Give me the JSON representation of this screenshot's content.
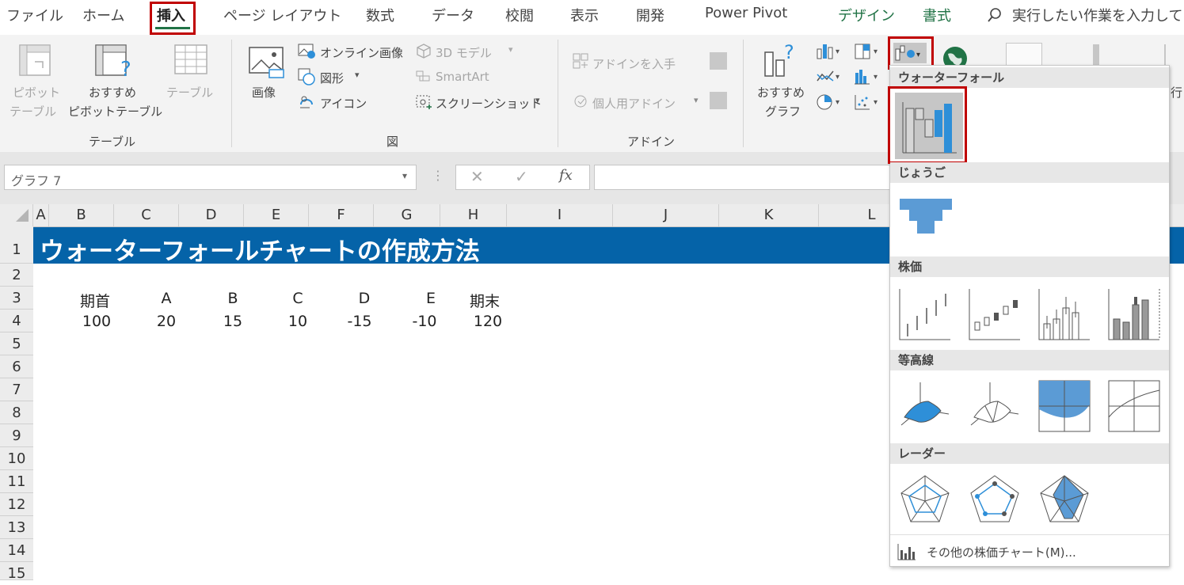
{
  "tabs": [
    {
      "label": "ファイル"
    },
    {
      "label": "ホーム"
    },
    {
      "label": "挿入"
    },
    {
      "label": "ページ レイアウト"
    },
    {
      "label": "数式"
    },
    {
      "label": "データ"
    },
    {
      "label": "校閲"
    },
    {
      "label": "表示"
    },
    {
      "label": "開発"
    },
    {
      "label": "Power Pivot"
    },
    {
      "label": "デザイン"
    },
    {
      "label": "書式"
    }
  ],
  "tellme": {
    "text": "実行したい作業を入力して"
  },
  "ribbon": {
    "table_group": {
      "pivot1": "ピボット",
      "pivot2": "テーブル",
      "rec1": "おすすめ",
      "rec2": "ピボットテーブル",
      "table": "テーブル",
      "label": "テーブル"
    },
    "illust_group": {
      "picture": "画像",
      "online": "オンライン画像",
      "shapes": "図形",
      "icons": "アイコン",
      "model3d": "3D モデル",
      "smartart": "SmartArt",
      "screenshot": "スクリーンショット",
      "label": "図"
    },
    "addin_group": {
      "get": "アドインを入手",
      "personal": "個人用アドイン",
      "label": "アドイン"
    },
    "chart_group": {
      "rec1": "おすすめ",
      "rec2": "グラフ",
      "partial": "行"
    }
  },
  "formula_bar": {
    "namebox": "グラフ 7",
    "fx": "fx"
  },
  "columns": [
    "A",
    "B",
    "C",
    "D",
    "E",
    "F",
    "G",
    "H",
    "I",
    "J",
    "K",
    "L"
  ],
  "rows": [
    "1",
    "2",
    "3",
    "4",
    "5",
    "6",
    "7",
    "8",
    "9",
    "10",
    "11",
    "12",
    "13",
    "14",
    "15"
  ],
  "sheet": {
    "title": "ウォーターフォールチャートの作成方法",
    "headers": [
      "期首",
      "A",
      "B",
      "C",
      "D",
      "E",
      "期末"
    ],
    "values": [
      "100",
      "20",
      "15",
      "10",
      "-15",
      "-10",
      "120"
    ]
  },
  "dropdown": {
    "sections": [
      "ウォーターフォール",
      "じょうご",
      "株価",
      "等高線",
      "レーダー"
    ],
    "more": "その他の株価チャート(M)..."
  },
  "colors": {
    "accent_green": "#217346",
    "title_blue": "#0563a8",
    "chart_blue": "#2e8fd8",
    "highlight_red": "#c00000"
  }
}
